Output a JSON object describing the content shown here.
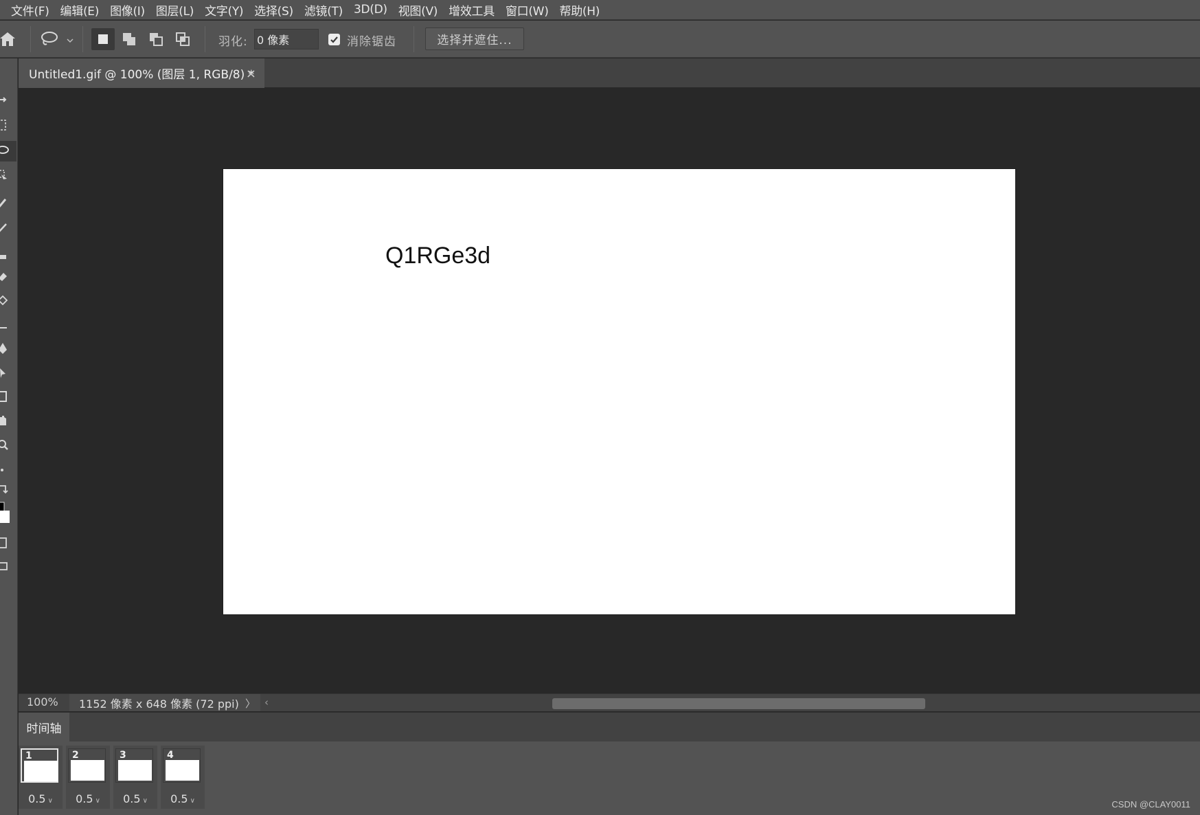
{
  "menu": [
    "文件(F)",
    "编辑(E)",
    "图像(I)",
    "图层(L)",
    "文字(Y)",
    "选择(S)",
    "滤镜(T)",
    "3D(D)",
    "视图(V)",
    "增效工具",
    "窗口(W)",
    "帮助(H)"
  ],
  "options": {
    "feather_label": "羽化:",
    "feather_value": "0 像素",
    "antialias_label": "消除锯齿",
    "antialias_checked": true,
    "select_mask_button": "选择并遮住..."
  },
  "document": {
    "tab_title": "Untitled1.gif @ 100% (图层 1, RGB/8) *",
    "tab_close": "×",
    "canvas_text": "Q1RGe3d"
  },
  "status": {
    "zoom": "100%",
    "doc_info": "1152 像素 x 648 像素 (72 ppi)",
    "arrow_right": "〉",
    "arrow_left": "‹"
  },
  "timeline": {
    "tab_label": "时间轴",
    "frames": [
      {
        "number": "1",
        "delay": "0.5",
        "selected": true
      },
      {
        "number": "2",
        "delay": "0.5",
        "selected": false
      },
      {
        "number": "3",
        "delay": "0.5",
        "selected": false
      },
      {
        "number": "4",
        "delay": "0.5",
        "selected": false
      }
    ]
  },
  "watermark": "CSDN @CLAY0011",
  "colors": {
    "panel": "#535353",
    "canvas_bg": "#282828",
    "document": "#ffffff"
  }
}
